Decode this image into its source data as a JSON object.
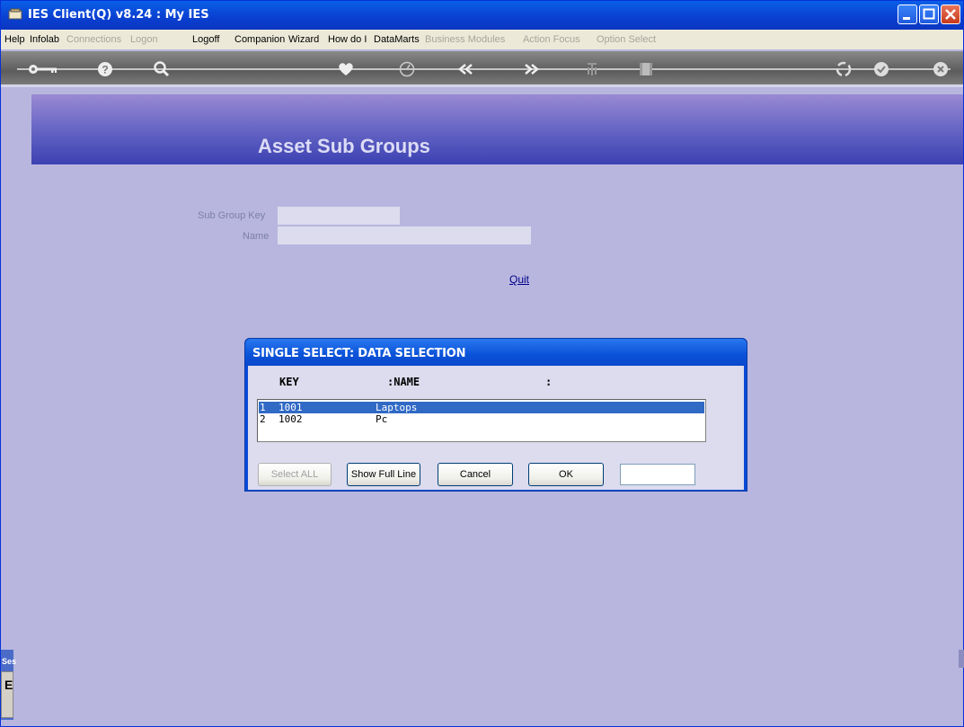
{
  "window": {
    "title": "IES Client(Q) v8.24 : My IES"
  },
  "menu": [
    {
      "label": "Help",
      "enabled": true
    },
    {
      "label": "Infolab",
      "enabled": true
    },
    {
      "label": "Connections",
      "enabled": false
    },
    {
      "label": "Logon",
      "enabled": false
    },
    {
      "label": "Logoff",
      "enabled": true
    },
    {
      "label": "Companion",
      "enabled": true
    },
    {
      "label": "Wizard",
      "enabled": true
    },
    {
      "label": "How do I",
      "enabled": true
    },
    {
      "label": "DataMarts",
      "enabled": true
    },
    {
      "label": "Business Modules",
      "enabled": false
    },
    {
      "label": "Action Focus",
      "enabled": false
    },
    {
      "label": "Option Select",
      "enabled": false
    }
  ],
  "toolbar": {
    "icons": [
      "key-icon",
      "help-icon",
      "search-icon",
      "heart-icon",
      "clock-icon",
      "back-icon",
      "forward-icon",
      "tree-icon",
      "film-icon",
      "recycle-icon",
      "check-icon",
      "close-icon"
    ]
  },
  "page": {
    "title": "Asset Sub Groups",
    "fields": {
      "sub_group_key_label": "Sub Group Key",
      "sub_group_key_value": "",
      "name_label": "Name",
      "name_value": ""
    },
    "quit_label": "Quit"
  },
  "dialog": {
    "title": "SINGLE SELECT: DATA SELECTION",
    "columns": {
      "key": "KEY",
      "name": ":NAME",
      "third": ":"
    },
    "rows": [
      {
        "index": "1",
        "key": "1001",
        "name": "Laptops",
        "selected": true
      },
      {
        "index": "2",
        "key": "1002",
        "name": "Pc",
        "selected": false
      }
    ],
    "buttons": {
      "select_all": "Select ALL",
      "show_full_line": "Show Full Line",
      "cancel": "Cancel",
      "ok": "OK"
    },
    "text_value": ""
  },
  "left_pane": {
    "label": "Ses",
    "glyph": "E"
  },
  "colors": {
    "background": "#b8b6de",
    "banner_dark": "#3c41b2",
    "titlebar": "#0a4fd8",
    "selection": "#316ac5"
  }
}
